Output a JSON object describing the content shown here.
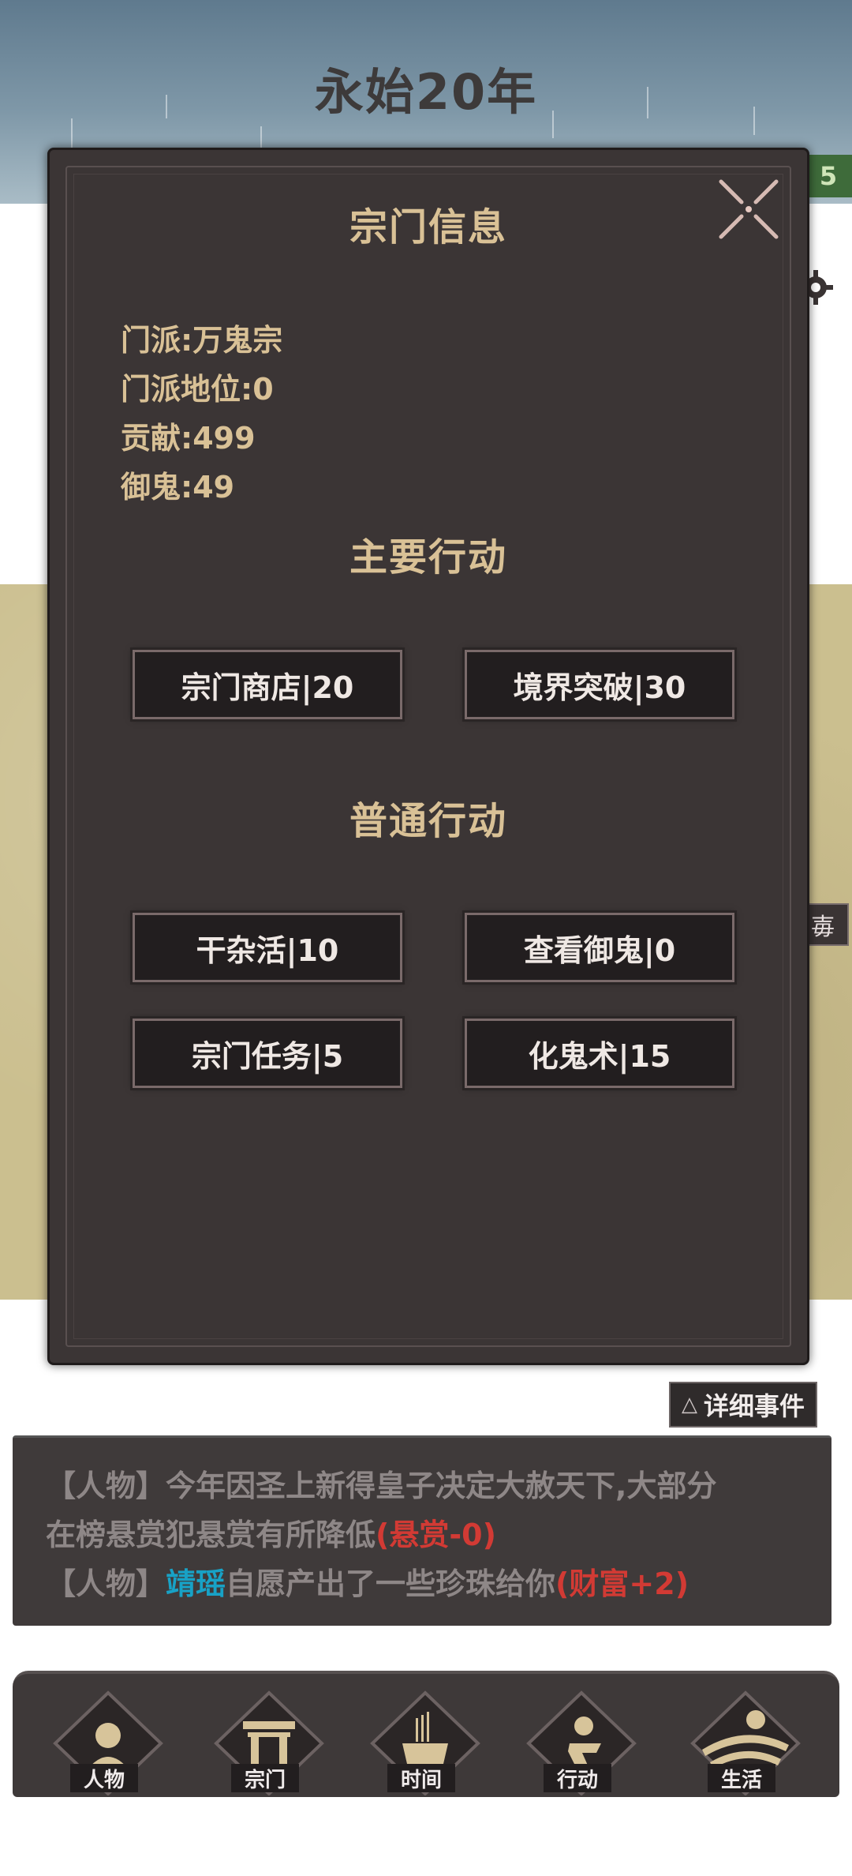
{
  "header": {
    "title": "永始20年",
    "side_tag": "5"
  },
  "side_button": {
    "label": "毐"
  },
  "modal": {
    "title": "宗门信息",
    "info": [
      "门派:万鬼宗",
      "门派地位:0",
      "贡献:499",
      "御鬼:49"
    ],
    "main_actions_title": "主要行动",
    "main_actions": [
      "宗门商店|20",
      "境界突破|30"
    ],
    "common_actions_title": "普通行动",
    "common_actions": [
      "干杂活|10",
      "查看御鬼|0",
      "宗门任务|5",
      "化鬼术|15"
    ]
  },
  "events": {
    "detail_button": "详细事件",
    "detail_icon": "△",
    "lines": [
      {
        "tag": "【人物】",
        "text": "今年因圣上新得皇子决定大赦天下,大部分"
      },
      {
        "tag": "",
        "text": "在榜悬赏犯悬赏有所降低",
        "effect": "(悬赏-0)"
      },
      {
        "tag": "【人物】",
        "name": "靖瑶",
        "text": "自愿产出了一些珍珠给你",
        "effect": "(财富+2)"
      }
    ]
  },
  "nav": {
    "items": [
      {
        "label": "人物",
        "icon": "person-icon"
      },
      {
        "label": "宗门",
        "icon": "gate-icon"
      },
      {
        "label": "时间",
        "icon": "incense-icon"
      },
      {
        "label": "行动",
        "icon": "action-icon"
      },
      {
        "label": "生活",
        "icon": "life-icon"
      }
    ]
  },
  "colors": {
    "panel_bg": "#3b3535",
    "gold_text": "#d9c196",
    "red_effect": "#d23a34",
    "cyan_name": "#18a2c6"
  }
}
